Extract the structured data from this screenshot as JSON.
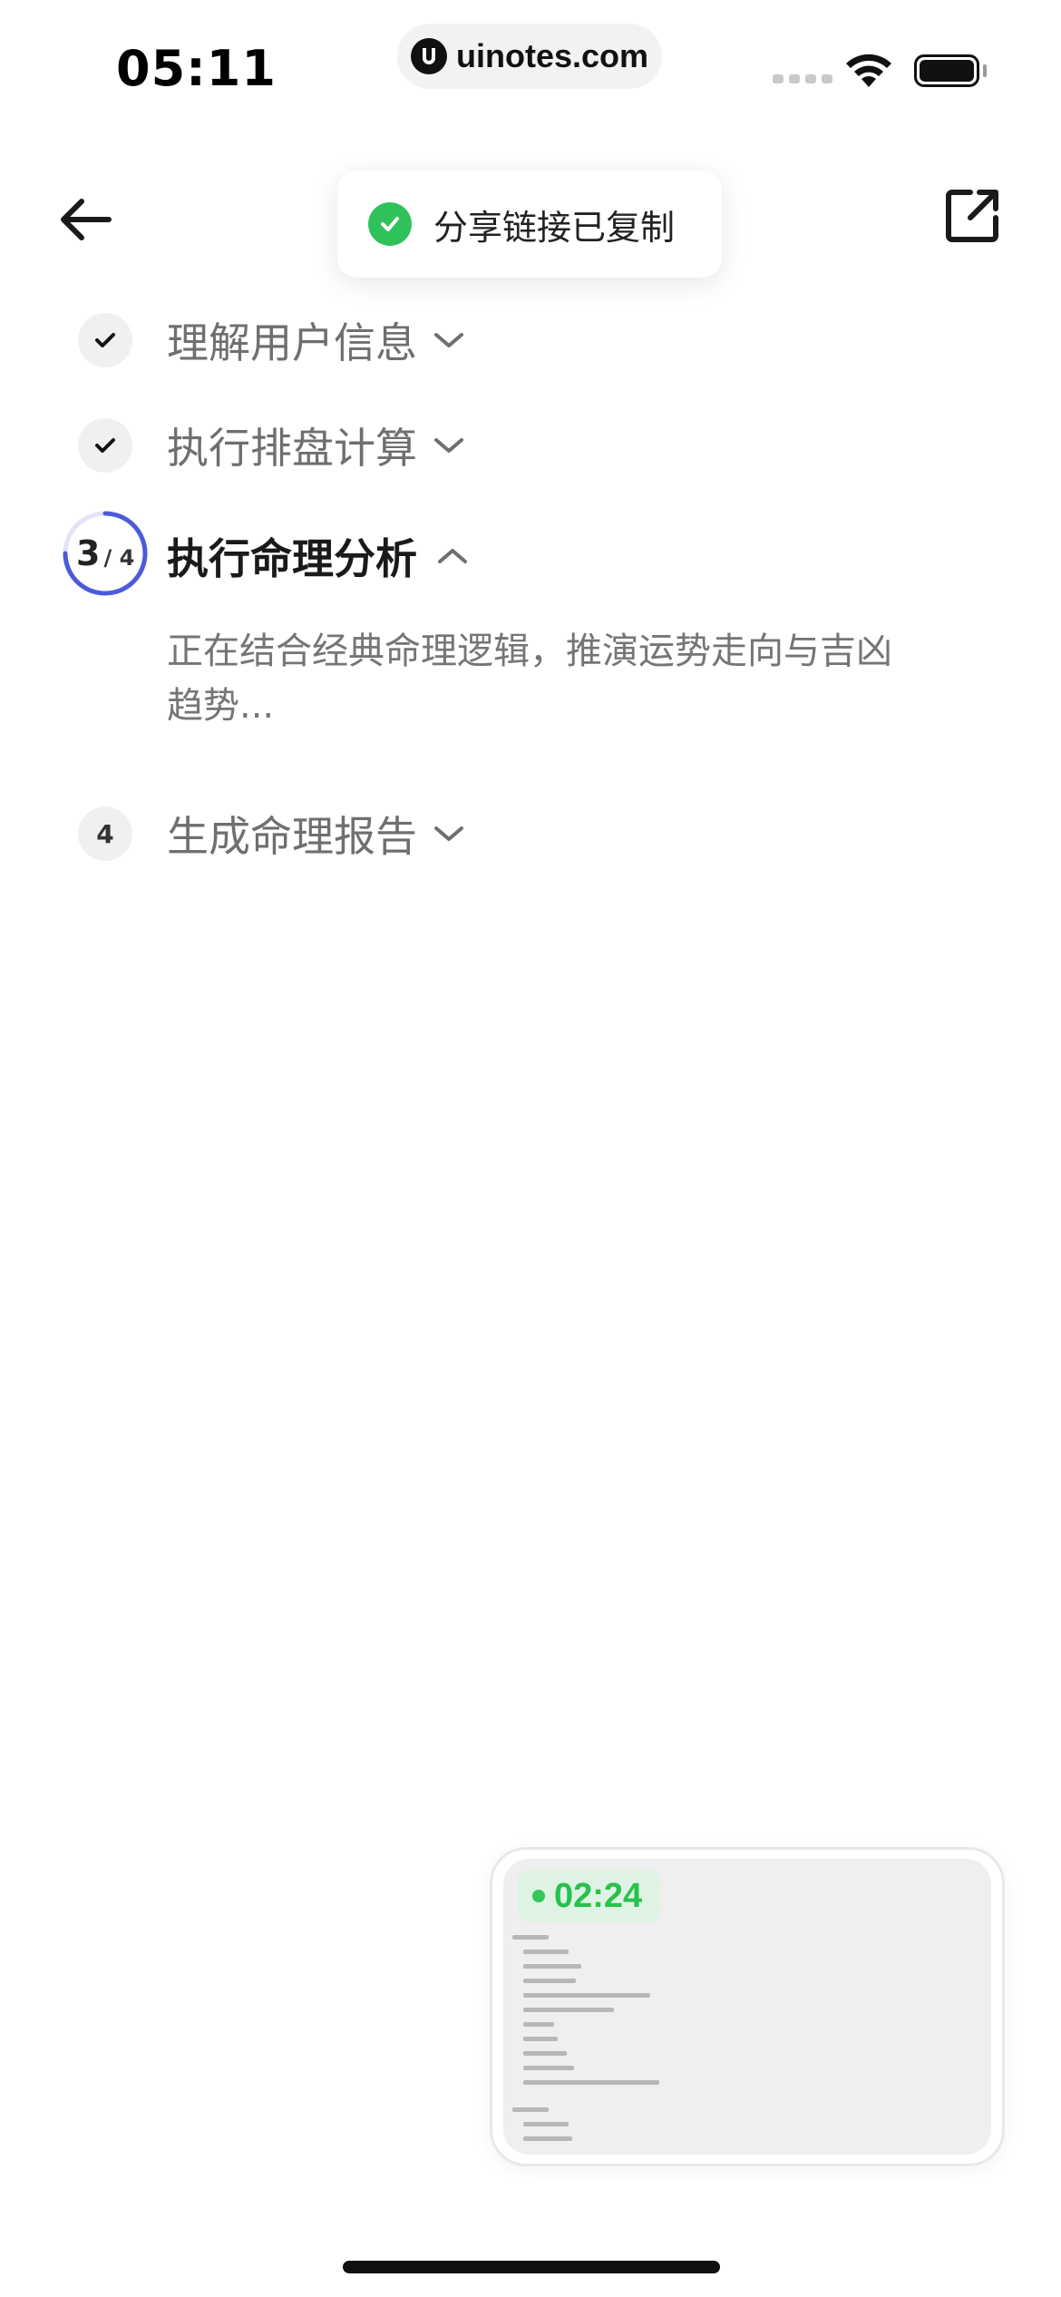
{
  "status_bar": {
    "time": "05:11",
    "url": "uinotes.com"
  },
  "toast": {
    "text": "分享链接已复制",
    "icon": "check-circle-icon",
    "color": "#2fc25b"
  },
  "nav": {
    "back_icon": "arrow-left-icon",
    "share_icon": "share-external-icon"
  },
  "steps": [
    {
      "label": "理解用户信息",
      "state": "done"
    },
    {
      "label": "执行排盘计算",
      "state": "done"
    },
    {
      "label": "执行命理分析",
      "state": "active",
      "progress_current": "3",
      "progress_total": "/ 4"
    },
    {
      "label": "生成命理报告",
      "state": "pending",
      "number": "4"
    }
  ],
  "active_step": {
    "description": "正在结合经典命理逻辑，推演运势走向与吉凶趋势..."
  },
  "preview": {
    "timer": "02:24",
    "timer_color": "#27c24c"
  },
  "colors": {
    "accent_blue": "#4b5bdc",
    "text_primary": "#1a1a1a",
    "text_secondary": "#6f6f6f"
  }
}
